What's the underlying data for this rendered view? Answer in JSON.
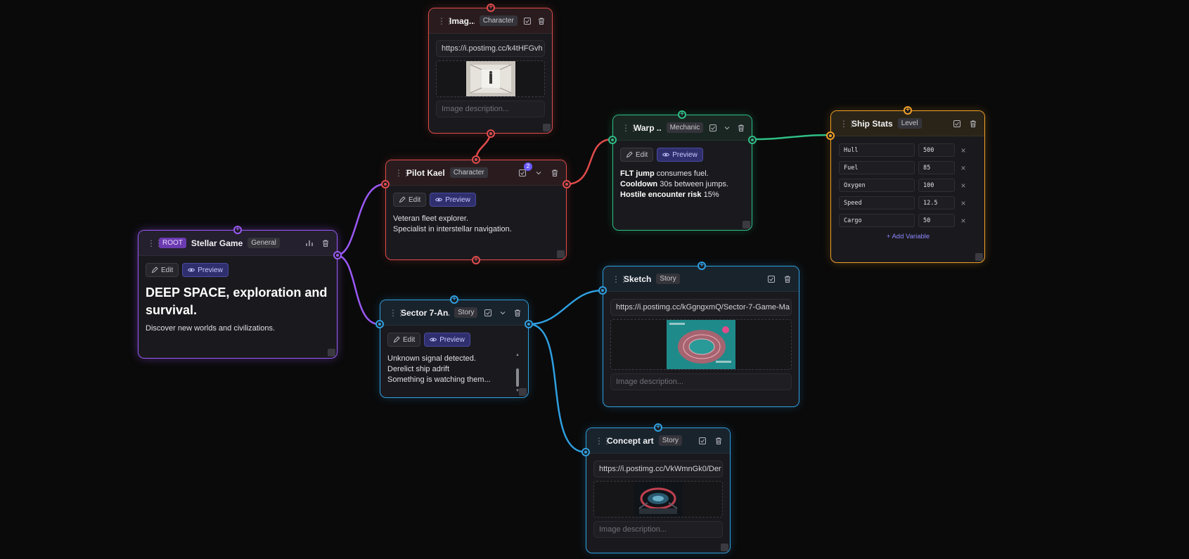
{
  "colors": {
    "root": "#9b59f5",
    "character": "#e04b4b",
    "mechanic": "#2fbf86",
    "level": "#f0a028",
    "story": "#2f9fe0"
  },
  "nodes": {
    "root": {
      "root_tag": "ROOT",
      "title": "Stellar Game",
      "tag": "General",
      "edit": "Edit",
      "preview": "Preview",
      "heading": "DEEP SPACE, exploration and survival.",
      "text": "Discover new worlds and civilizations."
    },
    "image": {
      "title": "Imag...",
      "tag": "Character",
      "url": "https://i.postimg.cc/k4tHFGvh",
      "desc_placeholder": "Image description..."
    },
    "pilot": {
      "title": "Pilot Kael",
      "tag": "Character",
      "badge": "2",
      "edit": "Edit",
      "preview": "Preview",
      "line1": "Veteran fleet explorer.",
      "line2": "Specialist in interstellar navigation."
    },
    "warp": {
      "title": "Warp ...",
      "tag": "Mechanic",
      "edit": "Edit",
      "preview": "Preview",
      "l1b": "FLT jump",
      "l1": " consumes fuel.",
      "l2b": "Cooldown",
      "l2": " 30s between jumps.",
      "l3b": "Hostile encounter risk",
      "l3": " 15%"
    },
    "ship": {
      "title": "Ship Stats",
      "tag": "Level",
      "vars": [
        {
          "k": "Hull",
          "v": "500"
        },
        {
          "k": "Fuel",
          "v": "85"
        },
        {
          "k": "Oxygen",
          "v": "100"
        },
        {
          "k": "Speed",
          "v": "12.5"
        },
        {
          "k": "Cargo",
          "v": "50"
        }
      ],
      "add": "+ Add Variable"
    },
    "sector": {
      "title": "Sector 7-An...",
      "tag": "Story",
      "edit": "Edit",
      "preview": "Preview",
      "line1": "Unknown signal detected.",
      "line2": "Derelict ship adrift",
      "line3": "Something is watching them..."
    },
    "sketch": {
      "title": "Sketch",
      "tag": "Story",
      "url": "https://i.postimg.cc/kGgngxmQ/Sector-7-Game-Ma",
      "desc_placeholder": "Image description..."
    },
    "concept": {
      "title": "Concept art",
      "tag": "Story",
      "url": "https://i.postimg.cc/VkWmnGk0/Der",
      "desc_placeholder": "Image description..."
    }
  }
}
